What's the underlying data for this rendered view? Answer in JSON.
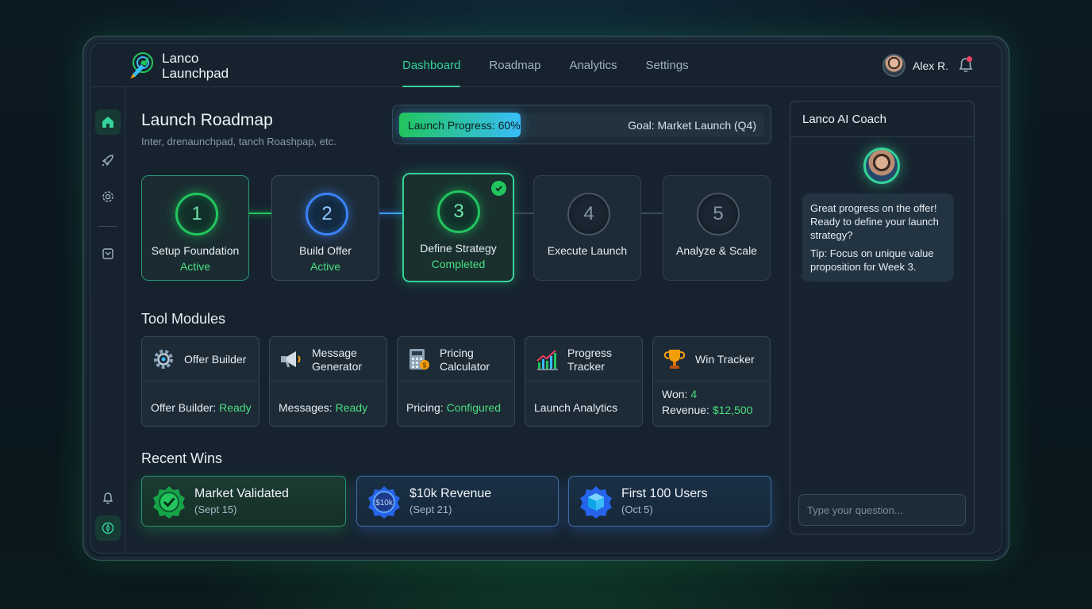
{
  "app": {
    "name_line1": "Lanco",
    "name_line2": "Launchpad"
  },
  "nav": {
    "items": [
      {
        "label": "Dashboard",
        "active": true
      },
      {
        "label": "Roadmap"
      },
      {
        "label": "Analytics"
      },
      {
        "label": "Settings"
      }
    ]
  },
  "user": {
    "name": "Alex R.",
    "has_notification": true
  },
  "sidebar": {
    "icons": [
      "home-icon",
      "rocket-icon",
      "gear-icon",
      "export-icon",
      "bell-icon",
      "compass-icon"
    ]
  },
  "page": {
    "title": "Launch Roadmap",
    "subtitle": "Inter, drenaunchpad, tanch Roashpap, etc."
  },
  "progress": {
    "label": "Launch Progress: 60%",
    "percent": 60,
    "goal": "Goal: Market Launch (Q4)"
  },
  "steps": [
    {
      "number": "1",
      "name": "Setup Foundation",
      "status": "Active",
      "state": "green"
    },
    {
      "number": "2",
      "name": "Build Offer",
      "status": "Active",
      "state": "blue"
    },
    {
      "number": "3",
      "name": "Define Strategy",
      "status": "Completed",
      "state": "completed"
    },
    {
      "number": "4",
      "name": "Execute Launch",
      "status": "",
      "state": "grey"
    },
    {
      "number": "5",
      "name": "Analyze & Scale",
      "status": "",
      "state": "grey"
    }
  ],
  "tools": {
    "title": "Tool Modules",
    "items": [
      {
        "name": "Offer Builder",
        "status_label": "Offer Builder: ",
        "status_value": "Ready",
        "icon": "gear-icon"
      },
      {
        "name_line1": "Message",
        "name_line2": "Generator",
        "status_label": "Messages: ",
        "status_value": "Ready",
        "icon": "megaphone-icon"
      },
      {
        "name_line1": "Pricing",
        "name_line2": "Calculator",
        "status_label": "Pricing: ",
        "status_value": "Configured",
        "icon": "calculator-icon"
      },
      {
        "name_line1": "Progress",
        "name_line2": "Tracker",
        "status_label": "Launch Analytics",
        "status_value": "",
        "icon": "chart-icon"
      },
      {
        "name": "Win Tracker",
        "won_label": "Won: ",
        "won_value": "4",
        "revenue_label": "Revenue: ",
        "revenue_value": "$12,500",
        "icon": "trophy-icon"
      }
    ]
  },
  "wins": {
    "title": "Recent Wins",
    "items": [
      {
        "title": "Market Validated",
        "date": "(Sept 15)",
        "icon": "check-badge-icon",
        "color": "green"
      },
      {
        "title": "$10k Revenue",
        "date": "(Sept 21)",
        "icon": "coin-badge-icon",
        "badge_text": "$10k",
        "color": "blue"
      },
      {
        "title": "First 100 Users",
        "date": "(Oct 5)",
        "icon": "cube-badge-icon",
        "color": "blue"
      }
    ]
  },
  "coach": {
    "title": "Lanco AI Coach",
    "message": "Great progress on the offer! Ready to define your launch strategy?",
    "tip": "Tip: Focus on unique value proposition for Week 3.",
    "input_placeholder": "Type your question..."
  },
  "colors": {
    "accent_green": "#34d399",
    "accent_blue": "#3b82f6",
    "alert": "#f43f5e"
  }
}
